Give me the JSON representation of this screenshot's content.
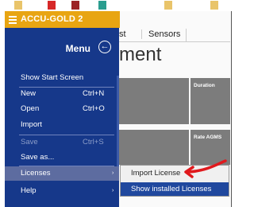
{
  "titlebar": {
    "title": "ACCU-GOLD 2"
  },
  "tabs": [
    "st",
    "Sensors"
  ],
  "page": {
    "title": "ment"
  },
  "tiles": {
    "duration": "Duration",
    "rate": "Rate AGMS"
  },
  "menu": {
    "header": "Menu",
    "items": [
      {
        "label": "Show Start Screen"
      },
      {
        "label": "New",
        "shortcut": "Ctrl+N"
      },
      {
        "label": "Open",
        "shortcut": "Ctrl+O"
      },
      {
        "label": "Import"
      },
      {
        "label": "Save",
        "shortcut": "Ctrl+S"
      },
      {
        "label": "Save as..."
      },
      {
        "label": "Licenses",
        "arrow": "›"
      },
      {
        "label": "Help",
        "arrow": "›"
      }
    ]
  },
  "submenu": {
    "items": [
      {
        "label": "Import License"
      },
      {
        "label": "Show installed Licenses"
      }
    ]
  },
  "colors": {
    "menu_bg": "#16388a",
    "titlebar": "#e8a512",
    "annotation": "#e0191d"
  }
}
